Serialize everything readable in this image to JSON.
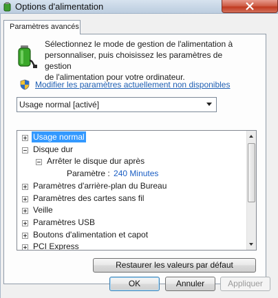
{
  "window": {
    "title": "Options d'alimentation"
  },
  "tab": {
    "label": "Paramètres avancés"
  },
  "description": {
    "line1": "Sélectionnez le mode de gestion de l'alimentation à",
    "line2": "personnaliser, puis choisissez les paramètres de gestion",
    "line3": "de l'alimentation pour votre ordinateur."
  },
  "modify_link": "Modifier les paramètres actuellement non disponibles",
  "plan_dropdown": {
    "selected": "Usage normal [activé]"
  },
  "tree": {
    "items": [
      {
        "label": "Usage normal",
        "expander": "collapsed",
        "selected": true
      },
      {
        "label": "Disque dur",
        "expander": "expanded"
      },
      {
        "label": "Arrêter le disque dur après",
        "expander": "expanded"
      },
      {
        "label": "Paramètre :",
        "value": "240 Minutes"
      },
      {
        "label": "Paramètres d'arrière-plan du Bureau",
        "expander": "collapsed"
      },
      {
        "label": "Paramètres des cartes sans fil",
        "expander": "collapsed"
      },
      {
        "label": "Veille",
        "expander": "collapsed"
      },
      {
        "label": "Paramètres USB",
        "expander": "collapsed"
      },
      {
        "label": "Boutons d'alimentation et capot",
        "expander": "collapsed"
      },
      {
        "label": "PCI Express",
        "expander": "collapsed"
      }
    ]
  },
  "buttons": {
    "restore": "Restaurer les valeurs par défaut",
    "ok": "OK",
    "cancel": "Annuler",
    "apply": "Appliquer"
  },
  "colors": {
    "selection": "#3399ff",
    "link": "#1f5fb3",
    "setting_value": "#1a5ec4",
    "close_button": "#c0391f"
  },
  "icons": [
    "power-options-icon",
    "close-icon",
    "battery-plug-icon",
    "uac-shield-icon",
    "chevron-down-icon",
    "tree-expander-icon",
    "scroll-arrow-icon"
  ]
}
